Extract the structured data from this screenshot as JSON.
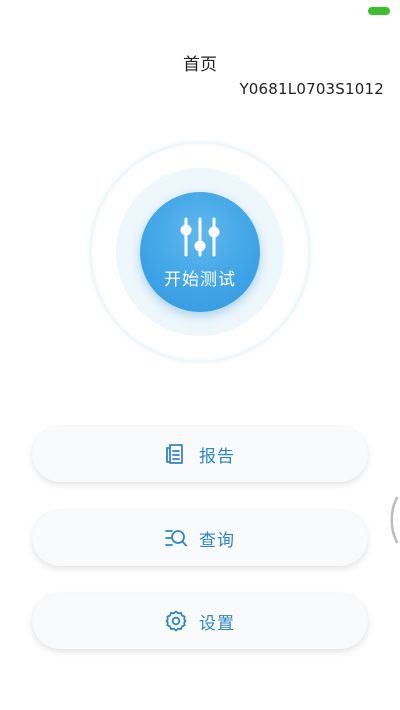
{
  "header": {
    "title": "首页",
    "device_id": "Y0681L0703S1012"
  },
  "start_test": {
    "label": "开始测试",
    "icon": "equalizer-icon"
  },
  "menu": {
    "report": {
      "label": "报告",
      "icon": "report-icon"
    },
    "query": {
      "label": "查询",
      "icon": "search-list-icon"
    },
    "settings": {
      "label": "设置",
      "icon": "gear-icon"
    }
  },
  "colors": {
    "accent": "#3ea3e6",
    "menu_text": "#2f86c5",
    "battery": "#3bbf2c"
  }
}
